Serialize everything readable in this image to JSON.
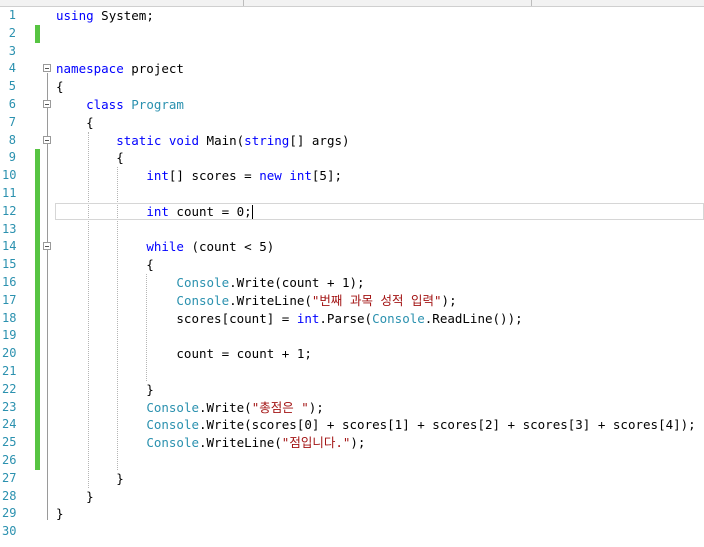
{
  "editor": {
    "lines": [
      {
        "n": "1",
        "tokens": [
          {
            "t": "kw",
            "v": "using"
          },
          {
            "t": "id",
            "v": " System;"
          }
        ]
      },
      {
        "n": "2",
        "tokens": []
      },
      {
        "n": "3",
        "tokens": []
      },
      {
        "n": "4",
        "tokens": [
          {
            "t": "kw",
            "v": "namespace"
          },
          {
            "t": "id",
            "v": " project"
          }
        ]
      },
      {
        "n": "5",
        "tokens": [
          {
            "t": "id",
            "v": "{"
          }
        ]
      },
      {
        "n": "6",
        "tokens": [
          {
            "t": "id",
            "v": "    "
          },
          {
            "t": "kw",
            "v": "class"
          },
          {
            "t": "id",
            "v": " "
          },
          {
            "t": "type",
            "v": "Program"
          }
        ]
      },
      {
        "n": "7",
        "tokens": [
          {
            "t": "id",
            "v": "    {"
          }
        ]
      },
      {
        "n": "8",
        "tokens": [
          {
            "t": "id",
            "v": "        "
          },
          {
            "t": "kw",
            "v": "static"
          },
          {
            "t": "id",
            "v": " "
          },
          {
            "t": "kw",
            "v": "void"
          },
          {
            "t": "id",
            "v": " Main("
          },
          {
            "t": "kw",
            "v": "string"
          },
          {
            "t": "id",
            "v": "[] args)"
          }
        ]
      },
      {
        "n": "9",
        "tokens": [
          {
            "t": "id",
            "v": "        {"
          }
        ]
      },
      {
        "n": "10",
        "tokens": [
          {
            "t": "id",
            "v": "            "
          },
          {
            "t": "kw",
            "v": "int"
          },
          {
            "t": "id",
            "v": "[] scores = "
          },
          {
            "t": "kw",
            "v": "new"
          },
          {
            "t": "id",
            "v": " "
          },
          {
            "t": "kw",
            "v": "int"
          },
          {
            "t": "id",
            "v": "[5];"
          }
        ]
      },
      {
        "n": "11",
        "tokens": []
      },
      {
        "n": "12",
        "tokens": [
          {
            "t": "id",
            "v": "            "
          },
          {
            "t": "kw",
            "v": "int"
          },
          {
            "t": "id",
            "v": " count = 0;"
          }
        ],
        "caret": true
      },
      {
        "n": "13",
        "tokens": []
      },
      {
        "n": "14",
        "tokens": [
          {
            "t": "id",
            "v": "            "
          },
          {
            "t": "kw",
            "v": "while"
          },
          {
            "t": "id",
            "v": " (count < 5)"
          }
        ]
      },
      {
        "n": "15",
        "tokens": [
          {
            "t": "id",
            "v": "            {"
          }
        ]
      },
      {
        "n": "16",
        "tokens": [
          {
            "t": "id",
            "v": "                "
          },
          {
            "t": "type",
            "v": "Console"
          },
          {
            "t": "id",
            "v": ".Write(count + 1);"
          }
        ]
      },
      {
        "n": "17",
        "tokens": [
          {
            "t": "id",
            "v": "                "
          },
          {
            "t": "type",
            "v": "Console"
          },
          {
            "t": "id",
            "v": ".WriteLine("
          },
          {
            "t": "str",
            "v": "\"번째 과목 성적 입력\""
          },
          {
            "t": "id",
            "v": ");"
          }
        ]
      },
      {
        "n": "18",
        "tokens": [
          {
            "t": "id",
            "v": "                scores[count] = "
          },
          {
            "t": "kw",
            "v": "int"
          },
          {
            "t": "id",
            "v": ".Parse("
          },
          {
            "t": "type",
            "v": "Console"
          },
          {
            "t": "id",
            "v": ".ReadLine());"
          }
        ]
      },
      {
        "n": "19",
        "tokens": []
      },
      {
        "n": "20",
        "tokens": [
          {
            "t": "id",
            "v": "                count = count + 1;"
          }
        ]
      },
      {
        "n": "21",
        "tokens": []
      },
      {
        "n": "22",
        "tokens": [
          {
            "t": "id",
            "v": "            }"
          }
        ]
      },
      {
        "n": "23",
        "tokens": [
          {
            "t": "id",
            "v": "            "
          },
          {
            "t": "type",
            "v": "Console"
          },
          {
            "t": "id",
            "v": ".Write("
          },
          {
            "t": "str",
            "v": "\"총점은 \""
          },
          {
            "t": "id",
            "v": ");"
          }
        ]
      },
      {
        "n": "24",
        "tokens": [
          {
            "t": "id",
            "v": "            "
          },
          {
            "t": "type",
            "v": "Console"
          },
          {
            "t": "id",
            "v": ".Write(scores[0] + scores[1] + scores[2] + scores[3] + scores[4]);"
          }
        ]
      },
      {
        "n": "25",
        "tokens": [
          {
            "t": "id",
            "v": "            "
          },
          {
            "t": "type",
            "v": "Console"
          },
          {
            "t": "id",
            "v": ".WriteLine("
          },
          {
            "t": "str",
            "v": "\"점입니다.\""
          },
          {
            "t": "id",
            "v": ");"
          }
        ]
      },
      {
        "n": "26",
        "tokens": []
      },
      {
        "n": "27",
        "tokens": [
          {
            "t": "id",
            "v": "        }"
          }
        ]
      },
      {
        "n": "28",
        "tokens": [
          {
            "t": "id",
            "v": "    }"
          }
        ]
      },
      {
        "n": "29",
        "tokens": [
          {
            "t": "id",
            "v": "}"
          }
        ]
      },
      {
        "n": "30",
        "tokens": []
      }
    ],
    "changed_lines": [
      "2",
      "9",
      "10",
      "11",
      "12",
      "13",
      "14",
      "15",
      "16",
      "17",
      "18",
      "19",
      "20",
      "21",
      "22",
      "23",
      "24",
      "25",
      "26"
    ],
    "fold_markers": [
      "4",
      "6",
      "8",
      "14"
    ],
    "colors": {
      "keyword": "#0000ff",
      "type": "#2b91af",
      "string": "#a31515",
      "line_number": "#2b91af",
      "change_bar": "#57c442"
    }
  }
}
